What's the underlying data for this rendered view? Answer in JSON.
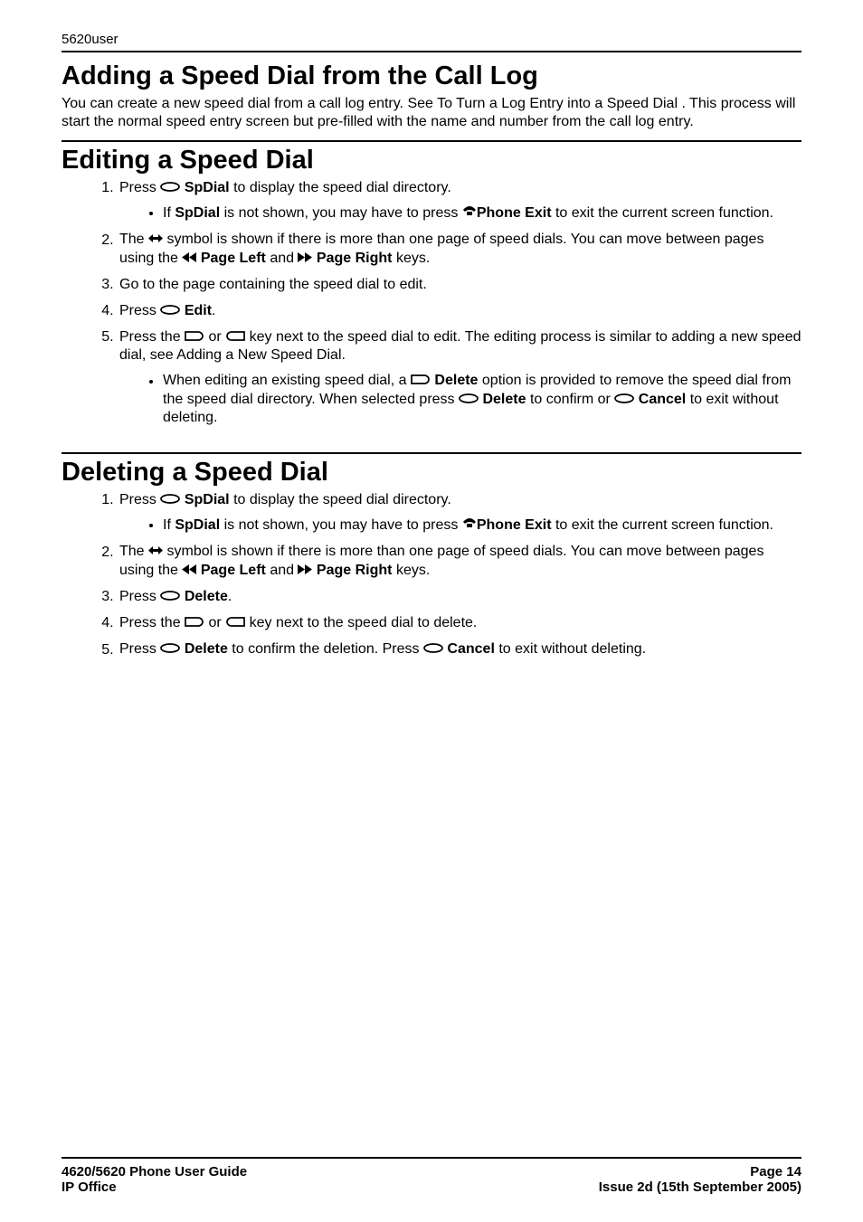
{
  "header": {
    "running_head": "5620user"
  },
  "sections": {
    "adding": {
      "title": "Adding a Speed Dial from the Call Log",
      "body": "You can create a new speed dial from a call log entry. See To Turn a Log Entry into a Speed Dial . This process will start the normal speed entry screen but pre-filled with the name and number from the call log entry."
    },
    "editing": {
      "title": "Editing a Speed Dial",
      "step1_a": "Press",
      "step1_b": "SpDial",
      "step1_c": "to display the speed dial directory.",
      "bullet1_a": "If",
      "bullet1_b": "SpDial",
      "bullet1_c": "is not shown, you may have to press",
      "bullet1_d": "Phone Exit",
      "bullet1_e": "to exit the current screen function.",
      "step2_a": "The",
      "step2_b": "symbol is shown if there is more than one page of speed dials. You can move between pages using the",
      "step2_c": "Page Left",
      "step2_d": "and",
      "step2_e": "Page Right",
      "step2_f": "keys.",
      "step3": "Go to the page containing the speed dial to edit.",
      "step4_a": "Press",
      "step4_b": "Edit",
      "step5_a": "Press the",
      "step5_b": "or",
      "step5_c": "key next to the speed dial to edit. The editing process is similar to adding a new speed dial, see Adding a New Speed Dial.",
      "bullet5_a": "When editing an existing speed dial, a",
      "bullet5_b": "Delete",
      "bullet5_c": "option is provided to remove the speed dial from the speed dial directory. When selected press",
      "bullet5_d": "Delete",
      "bullet5_e": "to confirm or",
      "bullet5_f": "Cancel",
      "bullet5_g": "to exit without deleting."
    },
    "deleting": {
      "title": "Deleting a Speed Dial",
      "step1_a": "Press",
      "step1_b": "SpDial",
      "step1_c": "to display the speed dial directory.",
      "bullet1_a": "If",
      "bullet1_b": "SpDial",
      "bullet1_c": "is not shown, you may have to press",
      "bullet1_d": "Phone Exit",
      "bullet1_e": "to exit the current screen function.",
      "step2_a": "The",
      "step2_b": "symbol is shown if there is more than one page of speed dials. You can move between pages using the",
      "step2_c": "Page Left",
      "step2_d": "and",
      "step2_e": "Page Right",
      "step2_f": "keys.",
      "step3_a": "Press",
      "step3_b": "Delete",
      "step4_a": "Press the",
      "step4_b": "or",
      "step4_c": "key next to the speed dial to delete.",
      "step5_a": "Press",
      "step5_b": "Delete",
      "step5_c": "to confirm the deletion. Press",
      "step5_d": "Cancel",
      "step5_e": "to exit without deleting."
    }
  },
  "footer": {
    "left1": "4620/5620 Phone User Guide",
    "left2": "IP Office",
    "right1": "Page 14",
    "right2": "Issue 2d (15th September 2005)"
  }
}
